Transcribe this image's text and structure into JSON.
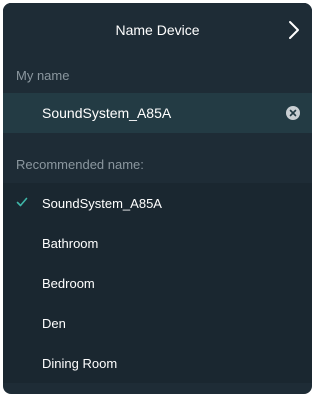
{
  "header": {
    "title": "Name Device",
    "next_icon": "chevron-right-icon"
  },
  "my_name": {
    "label": "My name",
    "value": "SoundSystem_A85A",
    "clear_icon": "clear-circle-icon"
  },
  "recommended": {
    "label": "Recommended name:",
    "items": [
      {
        "label": "SoundSystem_A85A",
        "selected": true
      },
      {
        "label": "Bathroom",
        "selected": false
      },
      {
        "label": "Bedroom",
        "selected": false
      },
      {
        "label": "Den",
        "selected": false
      },
      {
        "label": "Dining Room",
        "selected": false
      }
    ]
  },
  "colors": {
    "background": "#1e2c36",
    "input_row": "#233b44",
    "list_background": "#1a2730",
    "accent_check": "#3fb6a8",
    "muted_text": "#8b979f"
  }
}
